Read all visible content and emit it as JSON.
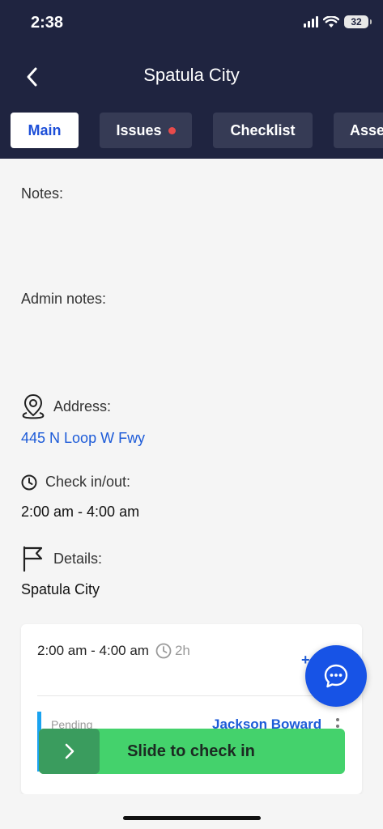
{
  "status_bar": {
    "time": "2:38",
    "battery": "32"
  },
  "header": {
    "title": "Spatula City"
  },
  "tabs": [
    {
      "label": "Main",
      "active": true
    },
    {
      "label": "Issues",
      "has_alert": true
    },
    {
      "label": "Checklist"
    },
    {
      "label": "Asse"
    }
  ],
  "notes": {
    "label": "Notes:"
  },
  "admin_notes": {
    "label": "Admin notes:"
  },
  "address": {
    "label": "Address:",
    "value": "445 N Loop W Fwy"
  },
  "checkin": {
    "label": "Check in/out:",
    "value": "2:00 am - 4:00 am"
  },
  "details": {
    "label": "Details:",
    "value": "Spatula City"
  },
  "card": {
    "time": "2:00 am - 4:00 am",
    "duration": "2h",
    "plus": "+",
    "status": "Pending",
    "assignee": "Jackson Boward"
  },
  "slider": {
    "label": "Slide to check in"
  },
  "colors": {
    "header_bg": "#1f2440",
    "accent": "#1d5bd8",
    "slider": "#44d26c",
    "fab": "#1753e6"
  },
  "icons": [
    "back-chevron-icon",
    "location-pin-icon",
    "clock-icon",
    "flag-icon",
    "chat-icon",
    "chevron-right-icon",
    "kebab-icon"
  ]
}
